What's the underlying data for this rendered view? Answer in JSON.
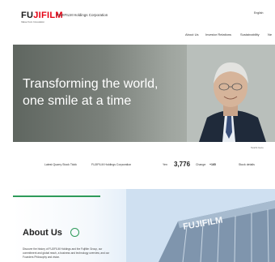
{
  "header": {
    "logo_text_fu": "FU",
    "logo_text_jifilm": "JIFILM",
    "logo_tagline": "Value from Innovation",
    "corporation_name": "FUJIFILM Holdings Corporation",
    "language": "English"
  },
  "nav": {
    "items": [
      {
        "label": "About Us"
      },
      {
        "label": "Investor Relations"
      },
      {
        "label": "Sustainability"
      },
      {
        "label": "Ne"
      }
    ]
  },
  "hero": {
    "headline_line1": "Transforming the world,",
    "headline_line2": "one smile at a time",
    "caption": "Teiichi Goto"
  },
  "stock": {
    "label": "Latest Quarry Stock Tickk",
    "company": "FUJIFILM Holdings Corporation",
    "price": "3,776",
    "change": "+165",
    "change_label": "Change",
    "price_label": "Yen",
    "trend_label": "Stock details"
  },
  "about": {
    "title": "About Us",
    "body": "Discover the history of FUJIFILM Holdings and the Fujifilm Group, our commitment and global reach, a business and technology overview, and our Founders Philosophy and vision.",
    "building_sign": "FUJIFILM"
  },
  "colors": {
    "accent_green": "#2e9b5a",
    "logo_red": "#e60012"
  }
}
